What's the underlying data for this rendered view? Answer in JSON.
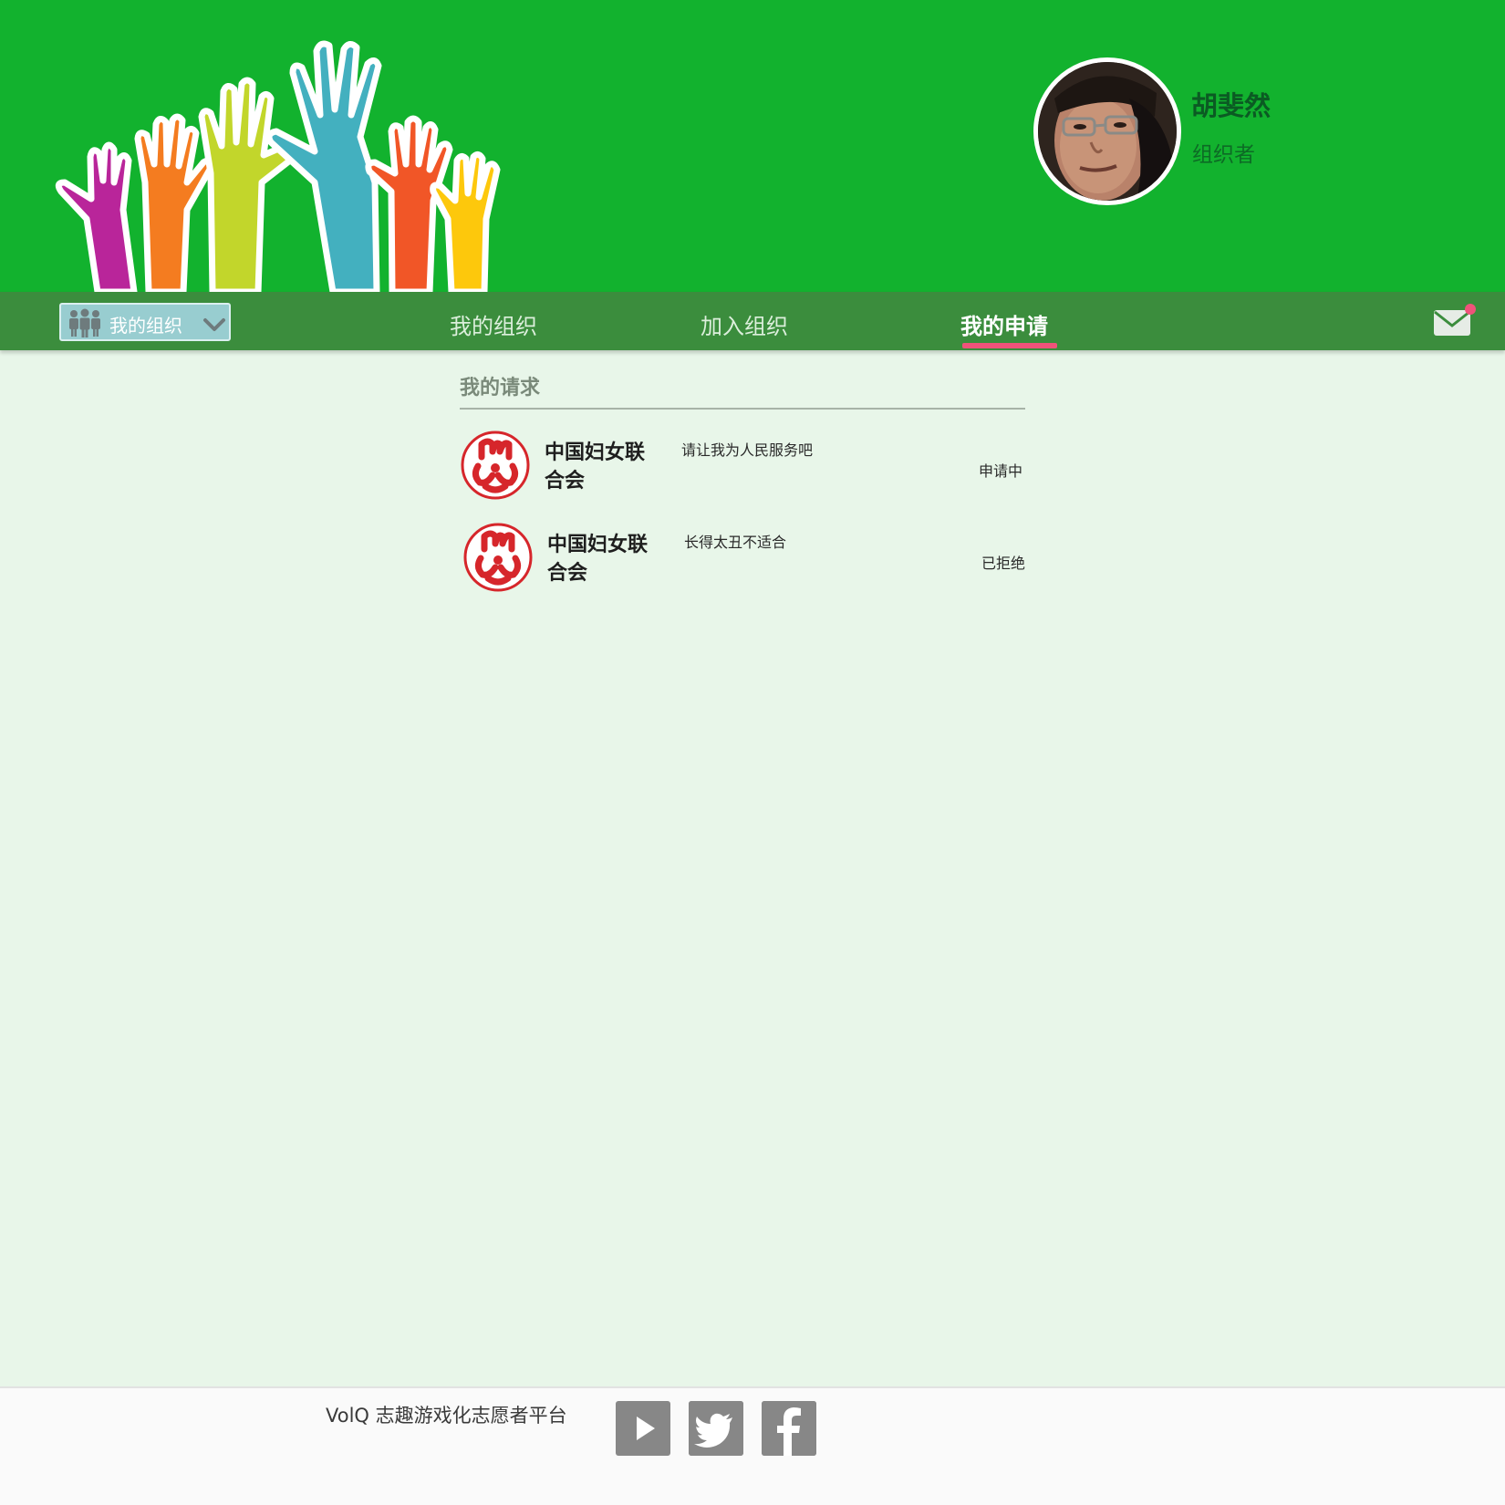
{
  "header": {
    "user": {
      "name": "胡斐然",
      "role": "组织者"
    }
  },
  "nav": {
    "org_select": {
      "label": "我的组织"
    },
    "tabs": [
      {
        "label": "我的组织",
        "active": false
      },
      {
        "label": "加入组织",
        "active": false
      },
      {
        "label": "我的申请",
        "active": true
      }
    ],
    "mail_has_notification": true
  },
  "main": {
    "section_title": "我的请求",
    "requests": [
      {
        "org_name": "中国妇女联合会",
        "message": "请让我为人民服务吧",
        "status": "申请中"
      },
      {
        "org_name": "中国妇女联合会",
        "message": "长得太丑不适合",
        "status": "已拒绝"
      }
    ]
  },
  "footer": {
    "text": "VolQ 志趣游戏化志愿者平台",
    "social": [
      "youtube-icon",
      "twitter-icon",
      "facebook-icon"
    ]
  },
  "colors": {
    "header_bg": "#12b22e",
    "nav_bg": "#3b8d3d",
    "active_underline": "#f0527a",
    "notification_dot": "#f0527a",
    "page_bg": "#e8f6e9",
    "logo_red": "#d6262b"
  }
}
